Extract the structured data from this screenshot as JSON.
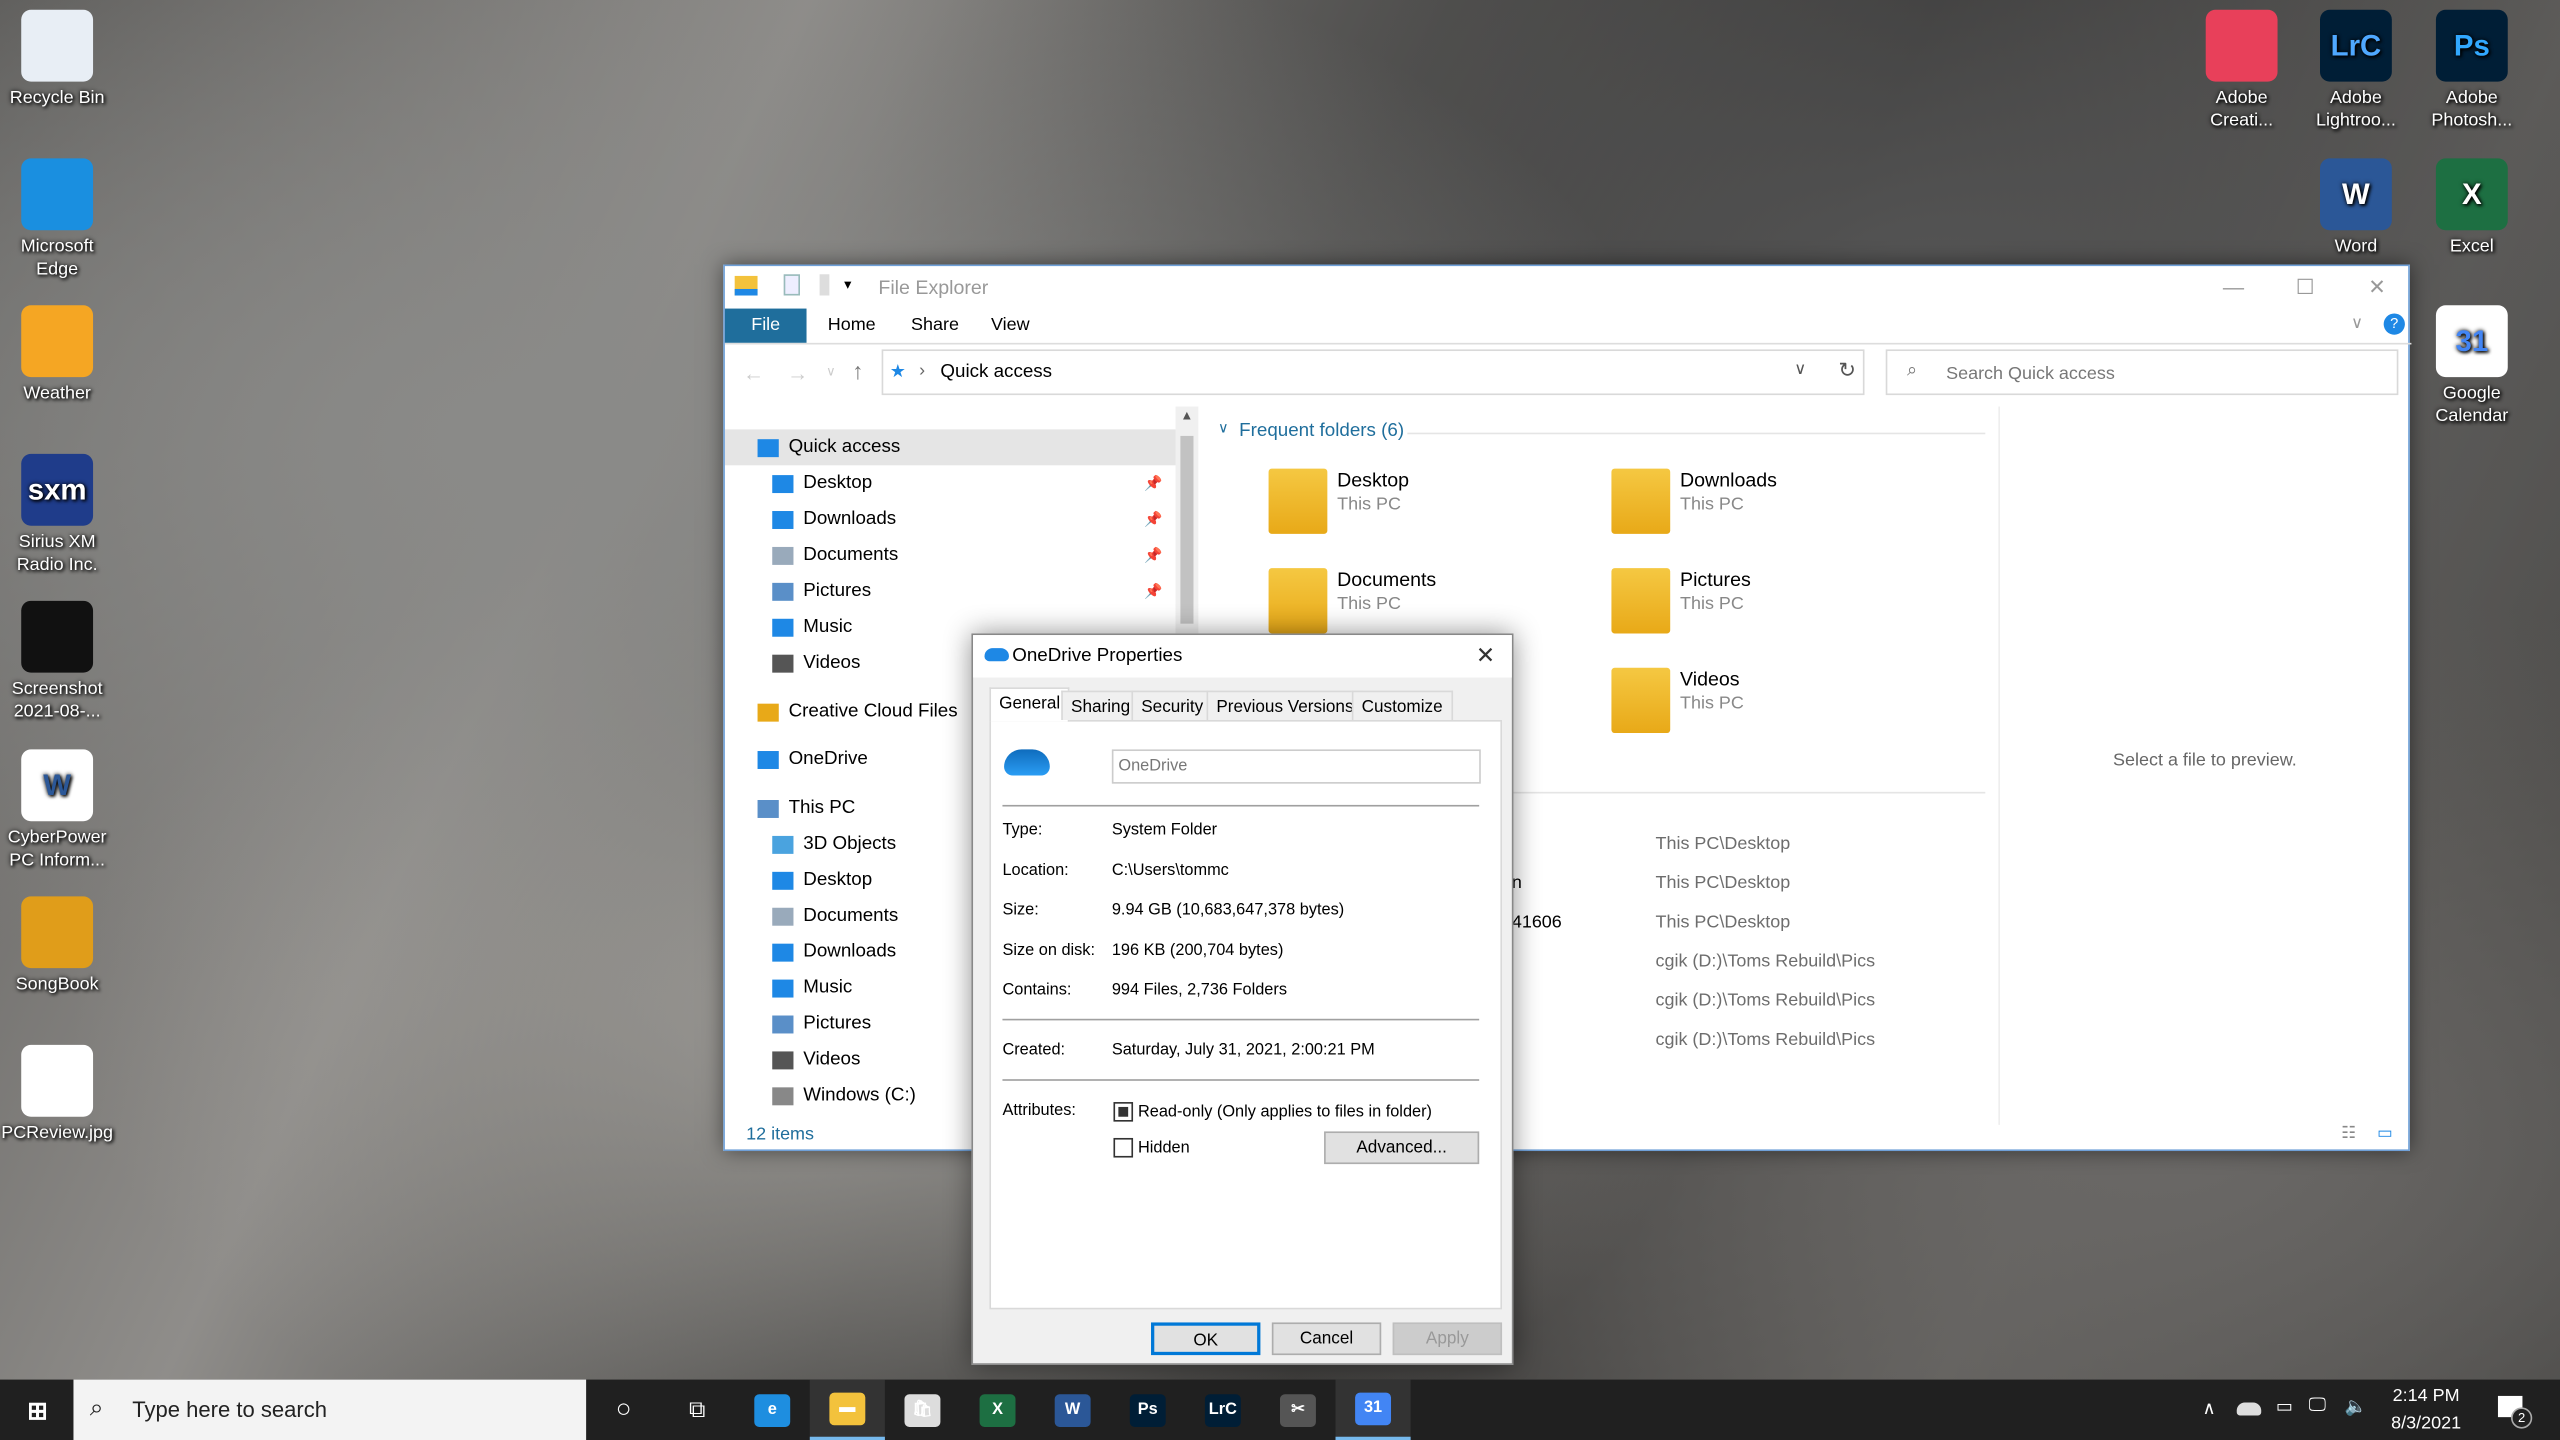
{
  "desktop": {
    "left_icons": [
      {
        "label": "Recycle Bin",
        "icon": "recycle-bin-icon"
      },
      {
        "label": "Microsoft Edge",
        "icon": "edge-icon"
      },
      {
        "label": "Weather",
        "icon": "weather-icon"
      },
      {
        "label": "Sirius XM Radio Inc.",
        "icon": "sxm-icon",
        "glyph": "sxm"
      },
      {
        "label": "Screenshot 2021-08-...",
        "icon": "image-thumbnail-icon"
      },
      {
        "label": "CyberPower PC Inform...",
        "icon": "word-document-icon",
        "glyph": "W"
      },
      {
        "label": "SongBook",
        "icon": "songbook-icon"
      },
      {
        "label": "PCReview.jpg",
        "icon": "image-thumbnail-icon"
      }
    ],
    "right_icons": [
      {
        "label": "Adobe Creati...",
        "icon": "adobe-creative-cloud-icon"
      },
      {
        "label": "Adobe Lightroo...",
        "icon": "lightroom-icon",
        "glyph": "LrC"
      },
      {
        "label": "Adobe Photosh...",
        "icon": "photoshop-icon",
        "glyph": "Ps"
      },
      {
        "label": "Word",
        "icon": "word-icon",
        "glyph": "W"
      },
      {
        "label": "Excel",
        "icon": "excel-icon",
        "glyph": "X"
      },
      {
        "label": "Google Calendar",
        "icon": "google-calendar-icon",
        "glyph": "31"
      }
    ]
  },
  "explorer": {
    "title": "File Explorer",
    "ribbon_tabs": [
      "File",
      "Home",
      "Share",
      "View"
    ],
    "address": "Quick access",
    "search_placeholder": "Search Quick access",
    "nav": [
      {
        "label": "Quick access",
        "level": 0,
        "selected": true
      },
      {
        "label": "Desktop",
        "level": 1,
        "pinned": true
      },
      {
        "label": "Downloads",
        "level": 1,
        "pinned": true
      },
      {
        "label": "Documents",
        "level": 1,
        "pinned": true
      },
      {
        "label": "Pictures",
        "level": 1,
        "pinned": true
      },
      {
        "label": "Music",
        "level": 1
      },
      {
        "label": "Videos",
        "level": 1
      },
      {
        "label": "Creative Cloud Files",
        "level": 0
      },
      {
        "label": "OneDrive",
        "level": 0
      },
      {
        "label": "This PC",
        "level": 0
      },
      {
        "label": "3D Objects",
        "level": 1
      },
      {
        "label": "Desktop",
        "level": 1
      },
      {
        "label": "Documents",
        "level": 1
      },
      {
        "label": "Downloads",
        "level": 1
      },
      {
        "label": "Music",
        "level": 1
      },
      {
        "label": "Pictures",
        "level": 1
      },
      {
        "label": "Videos",
        "level": 1
      },
      {
        "label": "Windows (C:)",
        "level": 1
      }
    ],
    "frequent_header": "Frequent folders (6)",
    "folders": [
      {
        "name": "Desktop",
        "location": "This PC"
      },
      {
        "name": "Downloads",
        "location": "This PC"
      },
      {
        "name": "Documents",
        "location": "This PC"
      },
      {
        "name": "Pictures",
        "location": "This PC"
      },
      {
        "name": "Videos",
        "location": "This PC"
      }
    ],
    "recent_fragments": [
      "n",
      "41606"
    ],
    "recent_paths": [
      "This PC\\Desktop",
      "This PC\\Desktop",
      "This PC\\Desktop",
      "cgik (D:)\\Toms Rebuild\\Pics",
      "cgik (D:)\\Toms Rebuild\\Pics",
      "cgik (D:)\\Toms Rebuild\\Pics"
    ],
    "preview_text": "Select a file to preview.",
    "status": "12 items",
    "accent": "#1f6e9c"
  },
  "dialog": {
    "title": "OneDrive Properties",
    "tabs": [
      "General",
      "Sharing",
      "Security",
      "Previous Versions",
      "Customize"
    ],
    "name_value": "OneDrive",
    "props": [
      {
        "label": "Type:",
        "value": "System Folder"
      },
      {
        "label": "Location:",
        "value": "C:\\Users\\tommc"
      },
      {
        "label": "Size:",
        "value": "9.94 GB (10,683,647,378 bytes)"
      },
      {
        "label": "Size on disk:",
        "value": "196 KB (200,704 bytes)"
      },
      {
        "label": "Contains:",
        "value": "994 Files, 2,736 Folders"
      }
    ],
    "created_label": "Created:",
    "created_value": "Saturday, July 31, 2021, 2:00:21 PM",
    "attributes_label": "Attributes:",
    "readonly_label": "Read-only (Only applies to files in folder)",
    "readonly_state": "indeterminate",
    "hidden_label": "Hidden",
    "hidden_checked": false,
    "advanced": "Advanced...",
    "ok": "OK",
    "cancel": "Cancel",
    "apply": "Apply"
  },
  "taskbar": {
    "search_placeholder": "Type here to search",
    "time": "2:14 PM",
    "date": "8/3/2021",
    "notifications": "2",
    "apps": [
      {
        "name": "edge",
        "glyph": "e",
        "color": "#1e8ee0"
      },
      {
        "name": "file-explorer",
        "glyph": "▬",
        "color": "#f3c23c",
        "running": true
      },
      {
        "name": "store",
        "glyph": "🛍",
        "color": "#ddd"
      },
      {
        "name": "excel",
        "glyph": "X",
        "color": "#1d6f42"
      },
      {
        "name": "word",
        "glyph": "W",
        "color": "#2b5797"
      },
      {
        "name": "photoshop",
        "glyph": "Ps",
        "color": "#001e36"
      },
      {
        "name": "lightroom",
        "glyph": "LrC",
        "color": "#001e36"
      },
      {
        "name": "snip",
        "glyph": "✂",
        "color": "#555"
      },
      {
        "name": "google-calendar",
        "glyph": "31",
        "color": "#4285f4",
        "running": true
      }
    ]
  }
}
